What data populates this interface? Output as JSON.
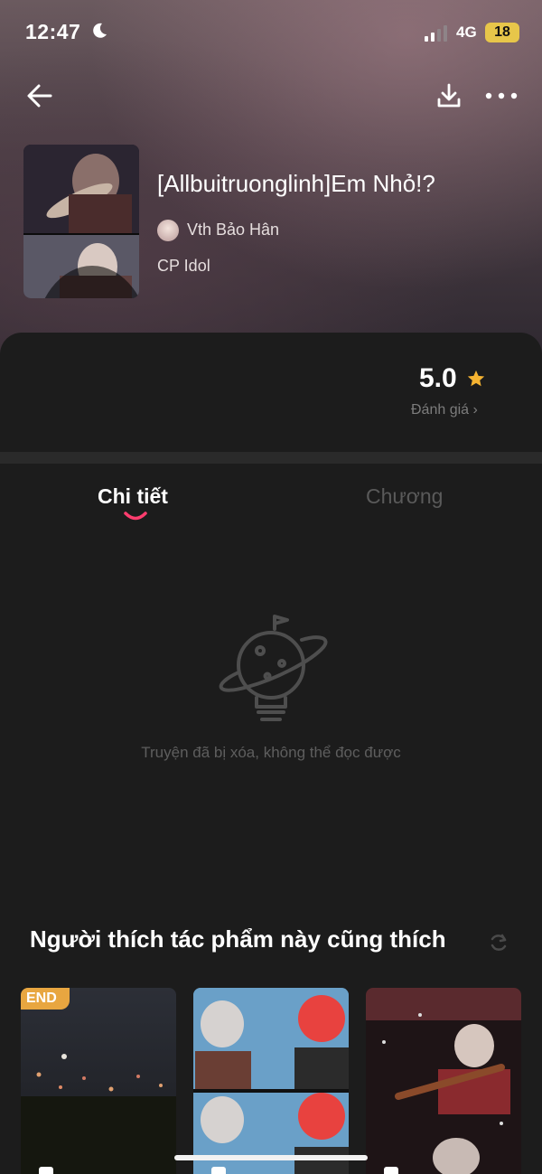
{
  "status_bar": {
    "time": "12:47",
    "network": "4G",
    "battery": "18"
  },
  "story": {
    "title": "[Allbuitruonglinh]Em Nhỏ!?",
    "author": "Vth Bảo Hân",
    "category": "CP Idol",
    "rating": "5.0",
    "rating_label": "Đánh giá ›"
  },
  "tabs": [
    {
      "label": "Chi tiết",
      "active": true
    },
    {
      "label": "Chương",
      "active": false
    }
  ],
  "empty_state": {
    "message": "Truyện đã bị xóa, không thể đọc được"
  },
  "recommendations": {
    "title": "Người thích tác phẩm này cũng thích",
    "items": [
      {
        "badge": "END"
      },
      {
        "badge": ""
      },
      {
        "badge": ""
      }
    ]
  },
  "colors": {
    "accent_pink": "#ff3d6e",
    "star": "#f5b331",
    "badge_end": "#e8a640",
    "battery": "#e7c64a"
  }
}
